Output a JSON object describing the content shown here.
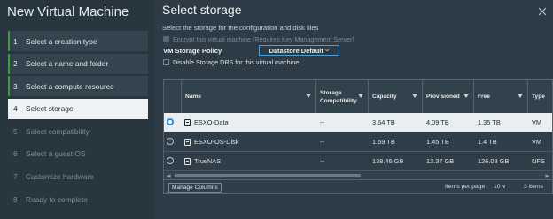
{
  "wizard": {
    "title": "New Virtual Machine",
    "steps": [
      {
        "num": "1",
        "label": "Select a creation type",
        "state": "done"
      },
      {
        "num": "2",
        "label": "Select a name and folder",
        "state": "done"
      },
      {
        "num": "3",
        "label": "Select a compute resource",
        "state": "done"
      },
      {
        "num": "4",
        "label": "Select storage",
        "state": "active"
      },
      {
        "num": "5",
        "label": "Select compatibility",
        "state": "pending"
      },
      {
        "num": "6",
        "label": "Select a guest OS",
        "state": "pending"
      },
      {
        "num": "7",
        "label": "Customize hardware",
        "state": "pending"
      },
      {
        "num": "8",
        "label": "Ready to complete",
        "state": "pending"
      }
    ]
  },
  "main": {
    "title": "Select storage",
    "subtitle": "Select the storage for the configuration and disk files",
    "encrypt_label": "Encrypt this virtual machine (Requires Key Management Server)",
    "policy_label": "VM Storage Policy",
    "policy_value": "Datastore Default",
    "drs_label": "Disable Storage DRS for this virtual machine"
  },
  "table": {
    "columns": [
      "Name",
      "Storage Compatibility",
      "Capacity",
      "Provisioned",
      "Free",
      "Type"
    ],
    "rows": [
      {
        "name": "ESXO-Data",
        "compat": "--",
        "capacity": "3.64 TB",
        "provisioned": "4.09 TB",
        "free": "1.35 TB",
        "type": "VM",
        "selected": true
      },
      {
        "name": "ESXO-OS-Disk",
        "compat": "--",
        "capacity": "1.69 TB",
        "provisioned": "1.45 TB",
        "free": "1.4 TB",
        "type": "VM",
        "selected": false
      },
      {
        "name": "TrueNAS",
        "compat": "--",
        "capacity": "138.46 GB",
        "provisioned": "12.37 GB",
        "free": "126.08 GB",
        "type": "NFS",
        "selected": false
      }
    ],
    "manage_columns": "Manage Columns",
    "items_per_page_label": "Items per page",
    "items_per_page_value": "10",
    "total": "3 items"
  },
  "colors": {
    "accent": "#2f8fd6",
    "done_marker": "#3f9c3a",
    "panel_bg": "#2c3b45",
    "sidebar_bg": "#28363f"
  }
}
